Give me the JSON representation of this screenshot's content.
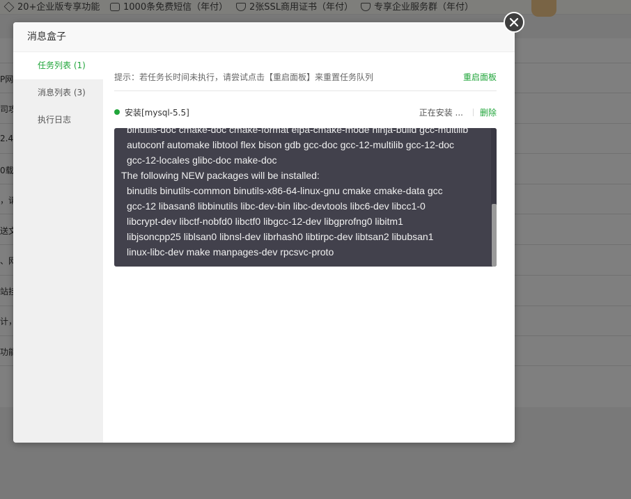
{
  "background": {
    "top_features": [
      {
        "icon": "diamond-icon",
        "label": "20+企业版专享功能"
      },
      {
        "icon": "mail-icon",
        "label": "1000条免费短信（年付）"
      },
      {
        "icon": "ssl-shield-icon",
        "label": "2张SSL商用证书（年付）"
      },
      {
        "icon": "heart-shield-icon",
        "label": "专享企业服务群（年付）"
      }
    ],
    "row_fragments": [
      "P网",
      "司攻",
      "2.4,",
      "0载",
      "，请",
      "送文",
      "、网",
      "站挂",
      "计，",
      "功能"
    ]
  },
  "modal": {
    "title": "消息盒子",
    "tabs": [
      {
        "label": "任务列表 (1)",
        "active": true
      },
      {
        "label": "消息列表 (3)",
        "active": false
      },
      {
        "label": "执行日志",
        "active": false
      }
    ],
    "notice": "提示：若任务长时间未执行，请尝试点击【重启面板】来重置任务队列",
    "restart_label": "重启面板",
    "task": {
      "name": "安装[mysql-5.5]",
      "status": "正在安装 ...",
      "delete_label": "删除"
    },
    "log_lines": [
      {
        "text": "binutils-doc cmake-doc cmake-format elpa-cmake-mode ninja-build gcc-multilib",
        "indent": true
      },
      {
        "text": "autoconf automake libtool flex bison gdb gcc-doc gcc-12-multilib gcc-12-doc",
        "indent": true
      },
      {
        "text": "gcc-12-locales glibc-doc make-doc",
        "indent": true
      },
      {
        "text": "The following NEW packages will be installed:",
        "indent": false
      },
      {
        "text": "binutils binutils-common binutils-x86-64-linux-gnu cmake cmake-data gcc",
        "indent": true
      },
      {
        "text": "gcc-12 libasan8 libbinutils libc-dev-bin libc-devtools libc6-dev libcc1-0",
        "indent": true
      },
      {
        "text": "libcrypt-dev libctf-nobfd0 libctf0 libgcc-12-dev libgprofng0 libitm1",
        "indent": true
      },
      {
        "text": "libjsoncpp25 liblsan0 libnsl-dev librhash0 libtirpc-dev libtsan2 libubsan1",
        "indent": true
      },
      {
        "text": "linux-libc-dev make manpages-dev rpcsvc-proto",
        "indent": true
      }
    ]
  },
  "colors": {
    "accent": "#20a53a",
    "log_bg": "#42414c"
  }
}
